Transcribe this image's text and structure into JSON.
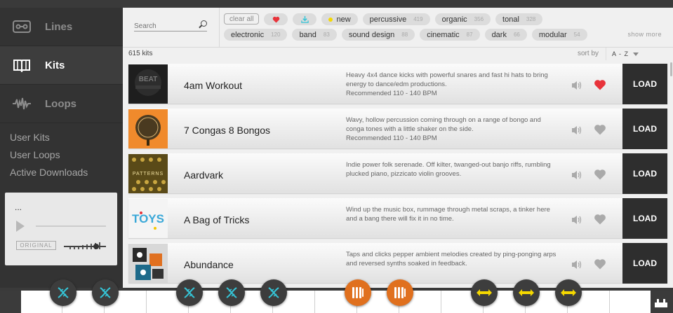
{
  "sidebar": {
    "nav": [
      {
        "label": "Lines",
        "icon": "cassette-icon",
        "active": false
      },
      {
        "label": "Kits",
        "icon": "book-icon",
        "active": true
      },
      {
        "label": "Loops",
        "icon": "waveform-icon",
        "active": false
      }
    ],
    "links": [
      "User Kits",
      "User Loops",
      "Active Downloads"
    ],
    "player": {
      "title": "...",
      "badge": "ORIGINAL"
    }
  },
  "filters": {
    "search_placeholder": "Search",
    "row1": [
      {
        "label": "clear all",
        "kind": "clear"
      },
      {
        "label": "",
        "kind": "heart"
      },
      {
        "label": "",
        "kind": "download"
      },
      {
        "label": "new",
        "kind": "new"
      },
      {
        "label": "percussive",
        "count": "419"
      },
      {
        "label": "organic",
        "count": "356"
      },
      {
        "label": "tonal",
        "count": "328"
      }
    ],
    "row2": [
      {
        "label": "electronic",
        "count": "120"
      },
      {
        "label": "band",
        "count": "83"
      },
      {
        "label": "sound design",
        "count": "88"
      },
      {
        "label": "cinematic",
        "count": "87"
      },
      {
        "label": "dark",
        "count": "66"
      },
      {
        "label": "modular",
        "count": "54"
      }
    ],
    "show_more": "show more"
  },
  "list_header": {
    "count": "615 kits",
    "sort_label": "sort by",
    "sort_value": "A - Z"
  },
  "kits": [
    {
      "name": "4am Workout",
      "desc": "Heavy 4x4 dance kicks with powerful snares and fast hi hats to bring energy to dance/edm productions.",
      "bpm": "Recommended 110 - 140 BPM",
      "favorite": true,
      "thumb": "beat-thumb",
      "load": "LOAD"
    },
    {
      "name": "7 Congas 8 Bongos",
      "desc": "Wavy, hollow percussion coming through on a range of bongo and conga tones with a little shaker on the side.",
      "bpm": "Recommended 110 - 140 BPM",
      "favorite": false,
      "thumb": "congas-thumb",
      "load": "LOAD"
    },
    {
      "name": "Aardvark",
      "desc": "Indie power folk serenade. Off kilter, twanged-out banjo riffs, rumbling plucked piano, pizzicato violin grooves.",
      "bpm": "",
      "favorite": false,
      "thumb": "patterns-thumb",
      "load": "LOAD"
    },
    {
      "name": "A Bag of Tricks",
      "desc": "Wind up the music box, rummage through metal scraps, a tinker here and a bang there will fix it in no time.",
      "bpm": "",
      "favorite": false,
      "thumb": "toys-thumb",
      "load": "LOAD"
    },
    {
      "name": "Abundance",
      "desc": "Taps and clicks pepper ambient melodies created by ping-ponging arps and reversed synths soaked in feedback.",
      "bpm": "",
      "favorite": false,
      "thumb": "abundance-thumb",
      "load": "LOAD"
    }
  ],
  "thumb_labels": {
    "beat": "BEAT",
    "patterns": "PATTERNS",
    "toys": "TOYS"
  },
  "colors": {
    "accent_red": "#e8333a",
    "arrow_yellow": "#f5d800",
    "teal": "#35c4d6",
    "orange": "#e0701e",
    "load_bg": "#2e2e2e"
  },
  "keyboard_buttons": [
    "dna-icon",
    "dna-icon",
    "dna-icon",
    "dna-icon",
    "dna-icon",
    "bars-icon",
    "bars-icon",
    "arrows-icon",
    "arrows-icon",
    "arrows-icon"
  ]
}
